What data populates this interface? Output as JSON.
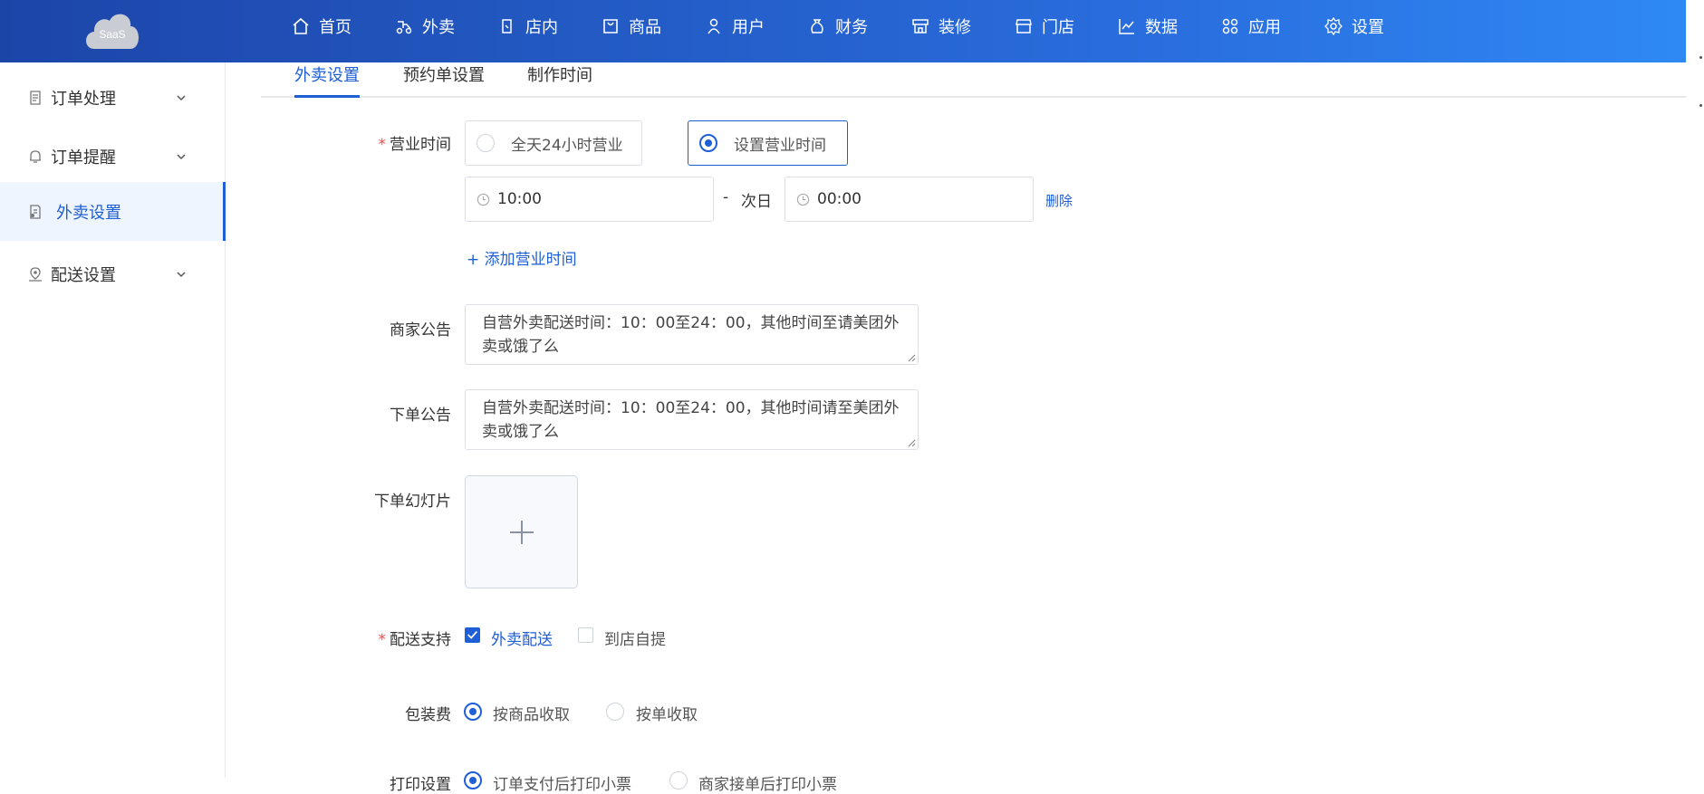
{
  "brand": {
    "logo_text": "SaaS"
  },
  "nav": [
    {
      "label": "首页",
      "icon": "home-icon"
    },
    {
      "label": "外卖",
      "icon": "delivery-icon"
    },
    {
      "label": "店内",
      "icon": "dine-in-icon"
    },
    {
      "label": "商品",
      "icon": "bag-icon"
    },
    {
      "label": "用户",
      "icon": "user-icon"
    },
    {
      "label": "财务",
      "icon": "money-bag-icon"
    },
    {
      "label": "装修",
      "icon": "storefront-icon"
    },
    {
      "label": "门店",
      "icon": "shop-icon"
    },
    {
      "label": "数据",
      "icon": "line-chart-icon"
    },
    {
      "label": "应用",
      "icon": "apps-icon"
    },
    {
      "label": "设置",
      "icon": "gear-icon"
    }
  ],
  "sidebar": {
    "items": [
      {
        "label": "订单处理",
        "icon": "document-icon",
        "expandable": true,
        "active": false
      },
      {
        "label": "订单提醒",
        "icon": "bell-icon",
        "expandable": true,
        "active": false
      },
      {
        "label": "外卖设置",
        "icon": "settings-doc-icon",
        "expandable": false,
        "active": true
      },
      {
        "label": "配送设置",
        "icon": "map-pin-icon",
        "expandable": true,
        "active": false
      }
    ]
  },
  "tabs": [
    {
      "label": "外卖设置",
      "active": true
    },
    {
      "label": "预约单设置",
      "active": false
    },
    {
      "label": "制作时间",
      "active": false
    }
  ],
  "form": {
    "business_hours": {
      "label": "营业时间",
      "required": "*",
      "options": [
        "全天24小时营业",
        "设置营业时间"
      ],
      "selected": "设置营业时间",
      "start_time": "10:00",
      "separator": "-",
      "next_day": "次日",
      "end_time": "00:00",
      "delete_label": "删除",
      "add_label": "+ 添加营业时间"
    },
    "merchant_notice": {
      "label": "商家公告",
      "value": "自营外卖配送时间：10：00至24：00，其他时间至请美团外卖或饿了么"
    },
    "order_notice": {
      "label": "下单公告",
      "value": "自营外卖配送时间：10：00至24：00，其他时间请至美团外卖或饿了么"
    },
    "slideshow": {
      "label": "下单幻灯片"
    },
    "delivery_support": {
      "label": "配送支持",
      "required": "*",
      "options": [
        {
          "label": "外卖配送",
          "checked": true
        },
        {
          "label": "到店自提",
          "checked": false
        }
      ]
    },
    "packaging_fee": {
      "label": "包装费",
      "options": [
        {
          "label": "按商品收取",
          "selected": true
        },
        {
          "label": "按单收取",
          "selected": false
        }
      ]
    },
    "print_settings": {
      "label": "打印设置",
      "options": [
        {
          "label": "订单支付后打印小票",
          "selected": true
        },
        {
          "label": "商家接单后打印小票",
          "selected": false
        }
      ]
    }
  },
  "colors": {
    "primary": "#1e5ed6",
    "header_start": "#1c45a8",
    "header_end": "#2f8af5",
    "required": "#f04a4a"
  }
}
